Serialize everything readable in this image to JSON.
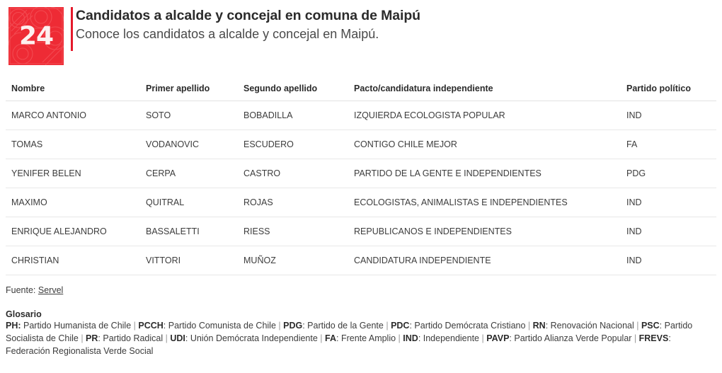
{
  "header": {
    "logo": {
      "text": "24",
      "bg_color": "#ee2b35",
      "name": "canal-24-horas-logo"
    },
    "accent_color": "#e4192b",
    "title": "Candidatos a alcalde y concejal en comuna de Maipú",
    "subtitle": "Conoce los candidatos a alcalde y concejal en Maipú."
  },
  "table": {
    "columns": [
      "Nombre",
      "Primer apellido",
      "Segundo apellido",
      "Pacto/candidatura independiente",
      "Partido político"
    ],
    "rows": [
      {
        "nombre": "MARCO ANTONIO",
        "primer_apellido": "SOTO",
        "segundo_apellido": "BOBADILLA",
        "pacto": "IZQUIERDA ECOLOGISTA POPULAR",
        "partido": "IND"
      },
      {
        "nombre": "TOMAS",
        "primer_apellido": "VODANOVIC",
        "segundo_apellido": "ESCUDERO",
        "pacto": "CONTIGO CHILE MEJOR",
        "partido": "FA"
      },
      {
        "nombre": "YENIFER BELEN",
        "primer_apellido": "CERPA",
        "segundo_apellido": "CASTRO",
        "pacto": "PARTIDO DE LA GENTE E INDEPENDIENTES",
        "partido": "PDG"
      },
      {
        "nombre": "MAXIMO",
        "primer_apellido": "QUITRAL",
        "segundo_apellido": "ROJAS",
        "pacto": "ECOLOGISTAS, ANIMALISTAS E INDEPENDIENTES",
        "partido": "IND"
      },
      {
        "nombre": "ENRIQUE ALEJANDRO",
        "primer_apellido": "BASSALETTI",
        "segundo_apellido": "RIESS",
        "pacto": "REPUBLICANOS E INDEPENDIENTES",
        "partido": "IND"
      },
      {
        "nombre": "CHRISTIAN",
        "primer_apellido": "VITTORI",
        "segundo_apellido": "MUÑOZ",
        "pacto": "CANDIDATURA INDEPENDIENTE",
        "partido": "IND"
      }
    ]
  },
  "source": {
    "label": "Fuente:",
    "link_text": "Servel"
  },
  "glossary": {
    "title": "Glosario",
    "entries": [
      {
        "abbr": "PH:",
        "desc": "Partido Humanista de Chile"
      },
      {
        "abbr": "PCCH",
        "desc": "Partido Comunista de Chile"
      },
      {
        "abbr": "PDG",
        "desc": "Partido de la Gente"
      },
      {
        "abbr": "PDC",
        "desc": "Partido Demócrata Cristiano"
      },
      {
        "abbr": "RN",
        "desc": "Renovación Nacional"
      },
      {
        "abbr": "PSC",
        "desc": "Partido Socialista de Chile"
      },
      {
        "abbr": "PR",
        "desc": "Partido Radical"
      },
      {
        "abbr": "UDI",
        "desc": "Unión Demócrata Independiente"
      },
      {
        "abbr": "FA",
        "desc": "Frente Amplio"
      },
      {
        "abbr": "IND",
        "desc": "Independiente"
      },
      {
        "abbr": "PAVP",
        "desc": "Partido Alianza Verde Popular"
      },
      {
        "abbr": "FREVS",
        "desc": "Federación Regionalista Verde Social"
      }
    ]
  }
}
